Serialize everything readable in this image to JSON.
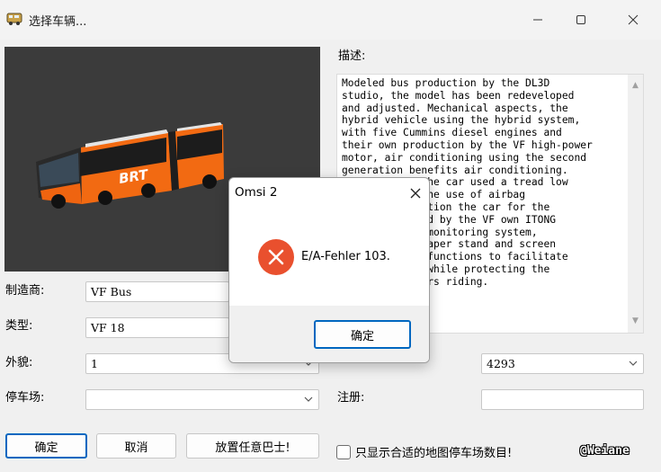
{
  "window": {
    "title": "选择车辆..."
  },
  "preview": {
    "bus_logo": "BRT"
  },
  "description": {
    "label": "描述:",
    "text": "Modeled bus production by the DL3D\nstudio, the model has been redeveloped\nand adjusted. Mechanical aspects, the\nhybrid vehicle using the hybrid system,\nwith five Cummins diesel engines and\ntheir own production by the VF high-power\nmotor, air conditioning using the second\ngeneration benefits air conditioning.\n          g, the car used a tread low\n          n, the use of airbag\n          addition the car for the\n          duced by the VF own ITONG\n          cle monitoring system,\n          ewspaper stand and screen\n          her functions to facilitate\n          on, while protecting the\n          engers riding."
  },
  "form": {
    "manufacturer_label": "制造商:",
    "manufacturer_value": "VF Bus",
    "type_label": "类型:",
    "type_value": "VF 18",
    "livery_label": "外貌:",
    "livery_value": "1",
    "number_value": "4293",
    "depot_label": "停车场:",
    "depot_value": "",
    "registration_label": "注册:",
    "registration_value": ""
  },
  "buttons": {
    "ok": "确定",
    "cancel": "取消",
    "place_any_bus": "放置任意巴士!"
  },
  "checkbox": {
    "label": "只显示合适的地图停车场数目!",
    "checked": false
  },
  "watermark": "@Weiane",
  "dialog": {
    "title": "Omsi 2",
    "message": "E/A-Fehler 103.",
    "ok": "确定"
  },
  "colors": {
    "accent": "#0067c0",
    "error": "#e9502e",
    "bus_orange": "#f26a12"
  }
}
